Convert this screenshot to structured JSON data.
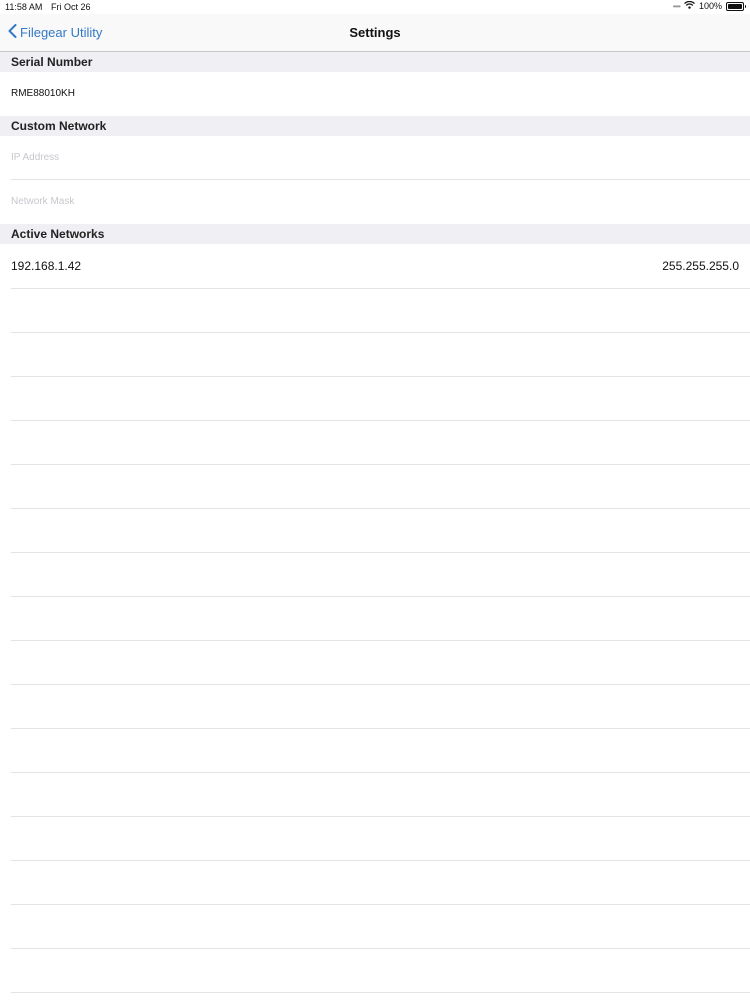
{
  "status_bar": {
    "time": "11:58 AM",
    "date": "Fri Oct 26",
    "battery": "100%",
    "wifi_icon": "wifi-icon",
    "battery_icon": "battery-icon"
  },
  "nav": {
    "back_label": "Filegear Utility",
    "back_icon": "chevron-left-icon",
    "title": "Settings",
    "accent_color": "#3478c8"
  },
  "sections": {
    "serial": {
      "header": "Serial Number",
      "value": "RME88010KH"
    },
    "custom_network": {
      "header": "Custom Network",
      "ip_placeholder": "IP Address",
      "mask_placeholder": "Network Mask"
    },
    "active_networks": {
      "header": "Active Networks",
      "items": [
        {
          "ip": "192.168.1.42",
          "mask": "255.255.255.0"
        }
      ]
    }
  }
}
